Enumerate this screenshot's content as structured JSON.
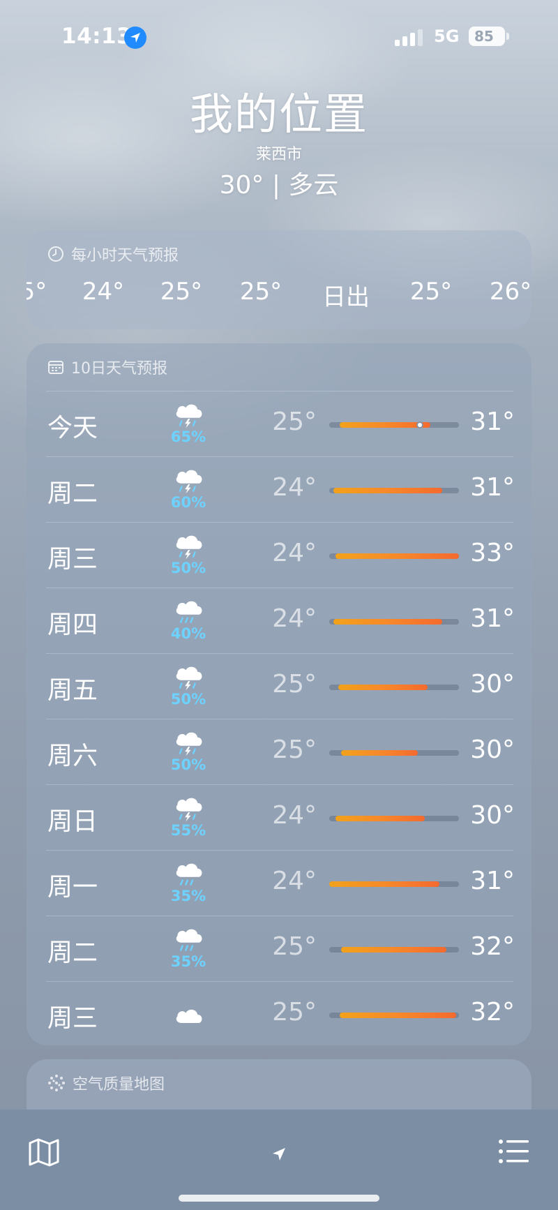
{
  "status_bar": {
    "time": "14:13",
    "network": "5G",
    "battery": "85"
  },
  "header": {
    "title": "我的位置",
    "city": "莱西市",
    "current": "30° | 多云"
  },
  "hourly": {
    "title": "每小时天气预报",
    "items": [
      "5°",
      "24°",
      "25°",
      "25°",
      "日出",
      "25°",
      "26°"
    ]
  },
  "daily": {
    "title": "10日天气预报",
    "rows": [
      {
        "day": "今天",
        "icon": "thunderstorm-icon",
        "pct": "65%",
        "low": "25°",
        "high": "31°",
        "bar_start": 0.08,
        "bar_end": 0.78,
        "now": 0.7
      },
      {
        "day": "周二",
        "icon": "thunderstorm-icon",
        "pct": "60%",
        "low": "24°",
        "high": "31°",
        "bar_start": 0.03,
        "bar_end": 0.87
      },
      {
        "day": "周三",
        "icon": "thunderstorm-icon",
        "pct": "50%",
        "low": "24°",
        "high": "33°",
        "bar_start": 0.05,
        "bar_end": 1.0
      },
      {
        "day": "周四",
        "icon": "rain-icon",
        "pct": "40%",
        "low": "24°",
        "high": "31°",
        "bar_start": 0.03,
        "bar_end": 0.87
      },
      {
        "day": "周五",
        "icon": "thunderstorm-icon",
        "pct": "50%",
        "low": "25°",
        "high": "30°",
        "bar_start": 0.07,
        "bar_end": 0.76
      },
      {
        "day": "周六",
        "icon": "thunderstorm-icon",
        "pct": "50%",
        "low": "25°",
        "high": "30°",
        "bar_start": 0.09,
        "bar_end": 0.68
      },
      {
        "day": "周日",
        "icon": "thunderstorm-icon",
        "pct": "55%",
        "low": "24°",
        "high": "30°",
        "bar_start": 0.05,
        "bar_end": 0.74
      },
      {
        "day": "周一",
        "icon": "rain-icon",
        "pct": "35%",
        "low": "24°",
        "high": "31°",
        "bar_start": 0.0,
        "bar_end": 0.85
      },
      {
        "day": "周二",
        "icon": "rain-icon",
        "pct": "35%",
        "low": "25°",
        "high": "32°",
        "bar_start": 0.09,
        "bar_end": 0.9
      },
      {
        "day": "周三",
        "icon": "cloud-icon",
        "pct": "",
        "low": "25°",
        "high": "32°",
        "bar_start": 0.08,
        "bar_end": 0.98
      }
    ]
  },
  "air_quality": {
    "title": "空气质量地图"
  },
  "colors": {
    "precip": "#6ed2ff",
    "bar_warm": "#f7892a",
    "location_blue": "#1f8bff"
  }
}
